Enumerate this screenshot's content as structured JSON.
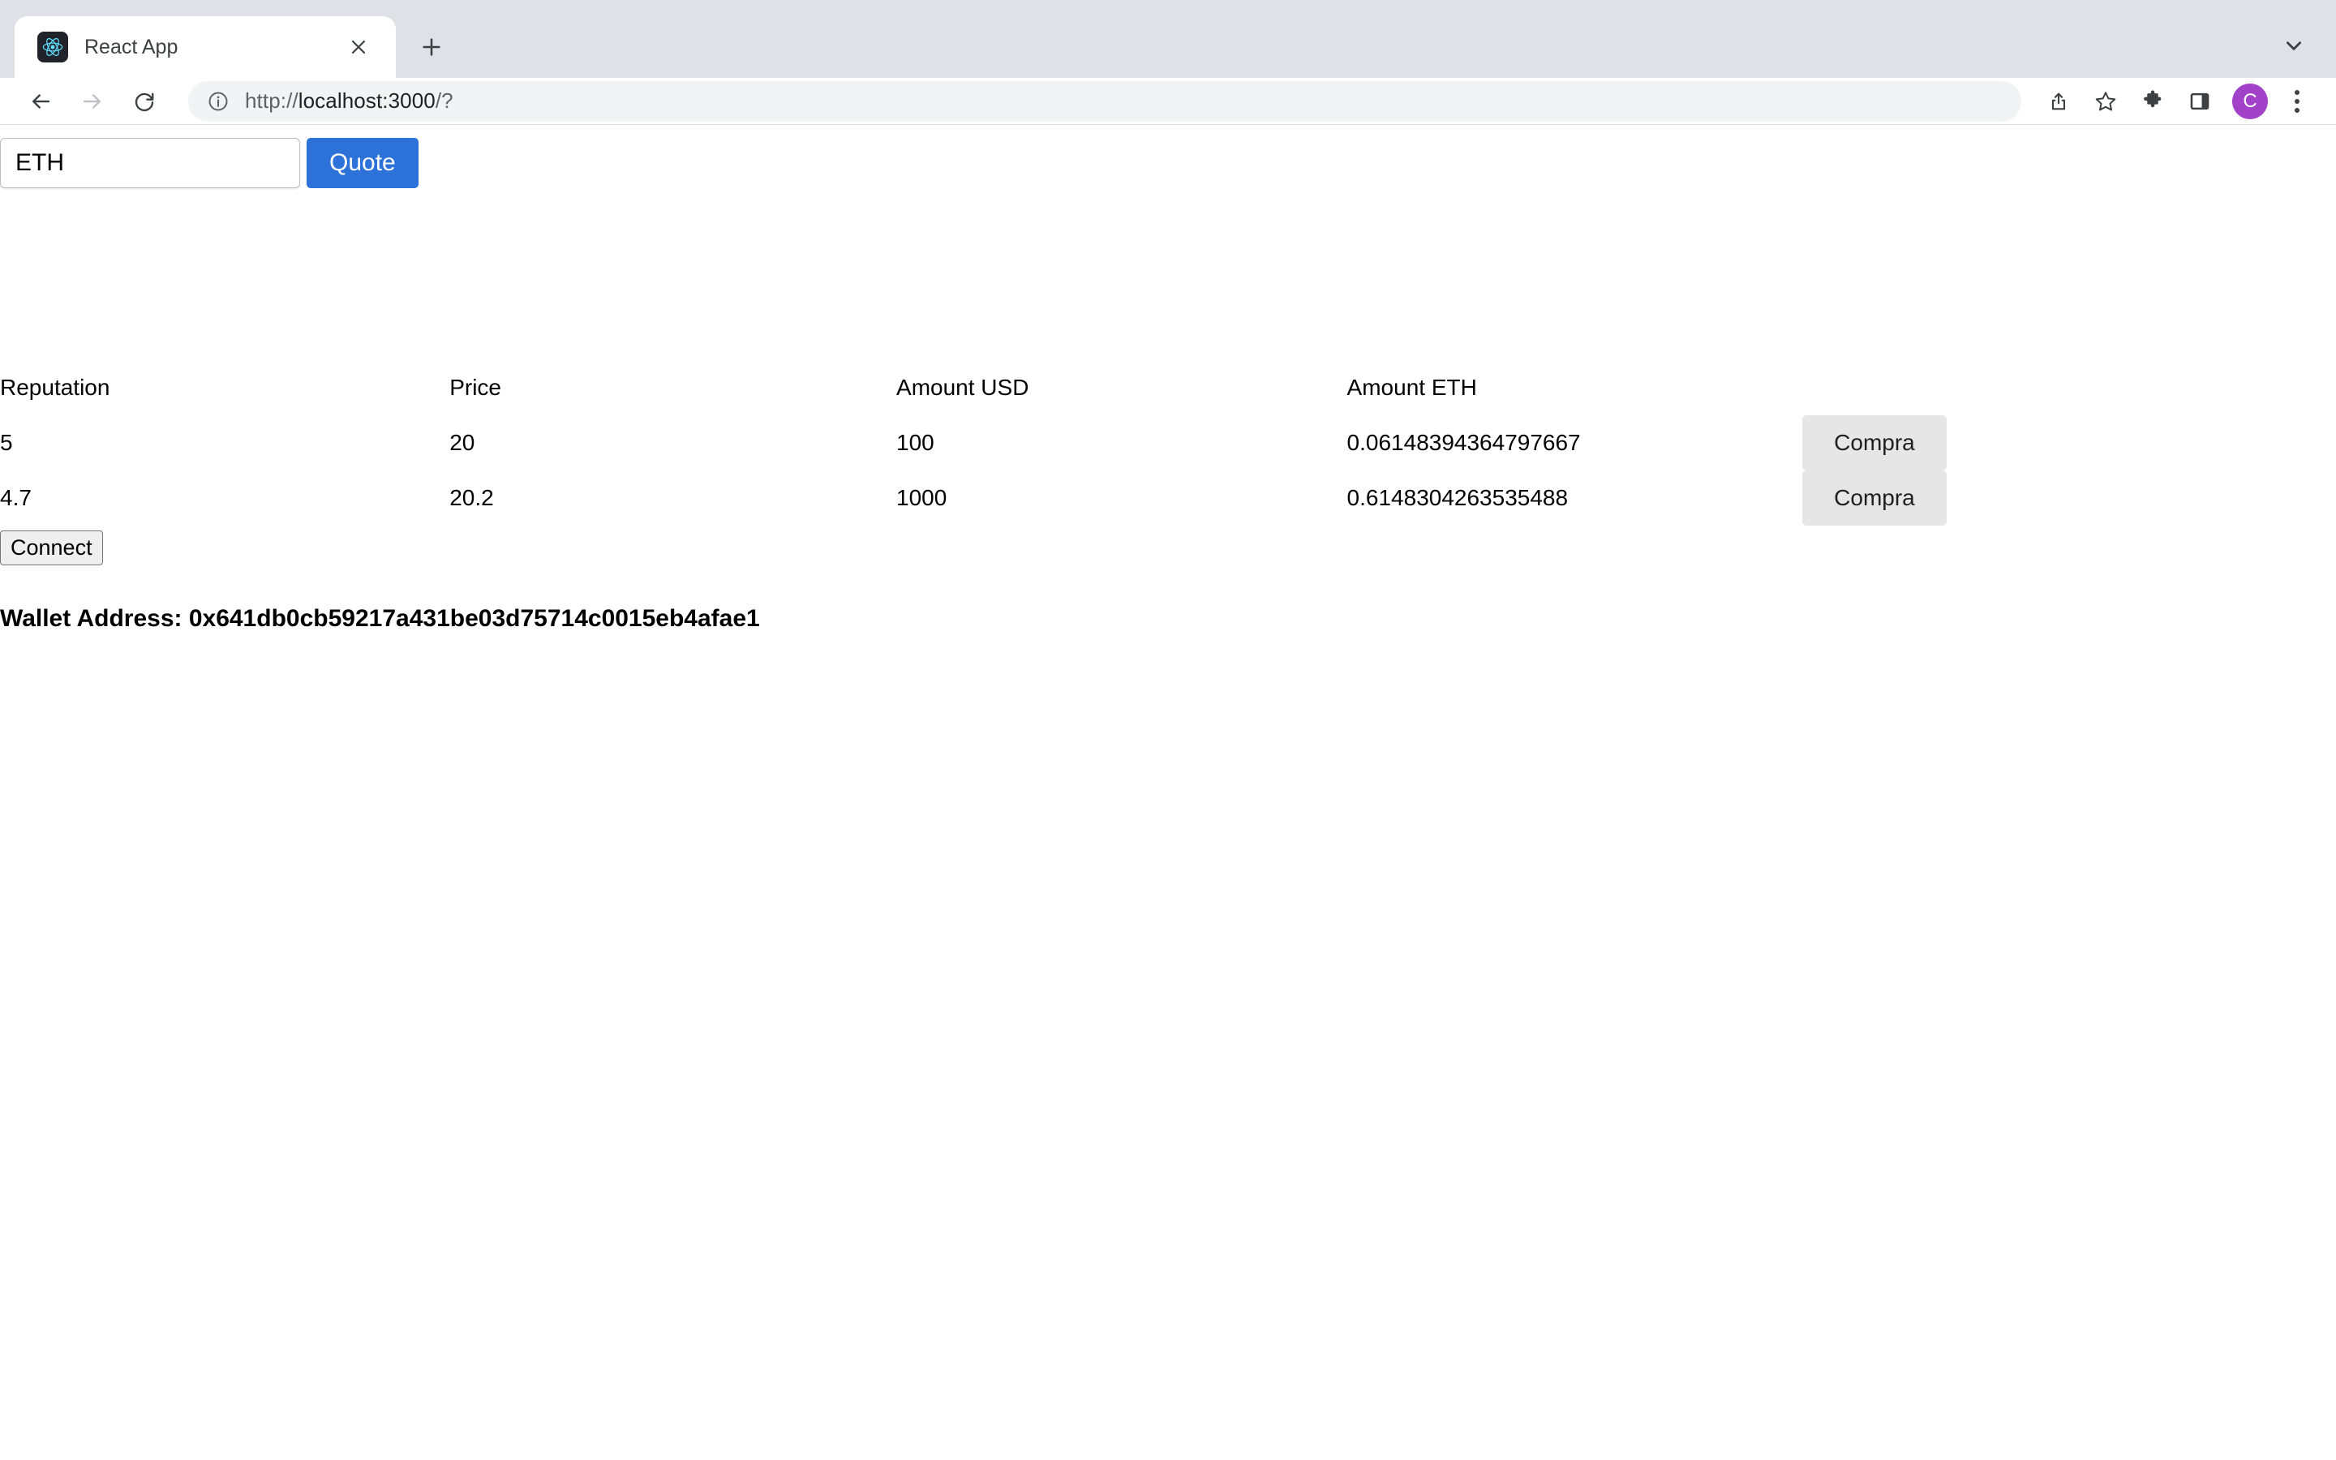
{
  "browser": {
    "tab": {
      "title": "React App",
      "favicon_name": "react-logo-icon",
      "close_label": "×"
    },
    "new_tab_label": "+",
    "tab_search_name": "chevron-down-icon",
    "nav": {
      "back_label": "←",
      "forward_label": "→",
      "reload_label": "⟳"
    },
    "omnibox": {
      "url_scheme": "http://",
      "url_host": "localhost:3000",
      "url_path": "/?",
      "full_url": "http://localhost:3000/?",
      "info_icon": "site-information-icon"
    },
    "actions": {
      "share": "share-icon",
      "bookmark": "star-icon",
      "extensions": "puzzle-piece-icon",
      "side_panel": "side-panel-icon",
      "menu": "three-dot-menu-icon"
    },
    "avatar": {
      "initial": "C",
      "color": "#a142c8"
    }
  },
  "app": {
    "search": {
      "value": "ETH",
      "placeholder": "",
      "button_label": "Quote",
      "button_color": "#2d72d9"
    },
    "table": {
      "headers": [
        "Reputation",
        "Price",
        "Amount USD",
        "Amount ETH"
      ],
      "rows": [
        {
          "reputation": "5",
          "price": "20",
          "amount_usd": "100",
          "amount_eth": "0.06148394364797667",
          "action_label": "Compra"
        },
        {
          "reputation": "4.7",
          "price": "20.2",
          "amount_usd": "1000",
          "amount_eth": "0.6148304263535488",
          "action_label": "Compra"
        }
      ]
    },
    "connect_label": "Connect",
    "wallet": {
      "label": "Wallet Address:",
      "address": "0x641db0cb59217a431be03d75714c0015eb4afae1",
      "full_text": "Wallet Address: 0x641db0cb59217a431be03d75714c0015eb4afae1"
    }
  }
}
